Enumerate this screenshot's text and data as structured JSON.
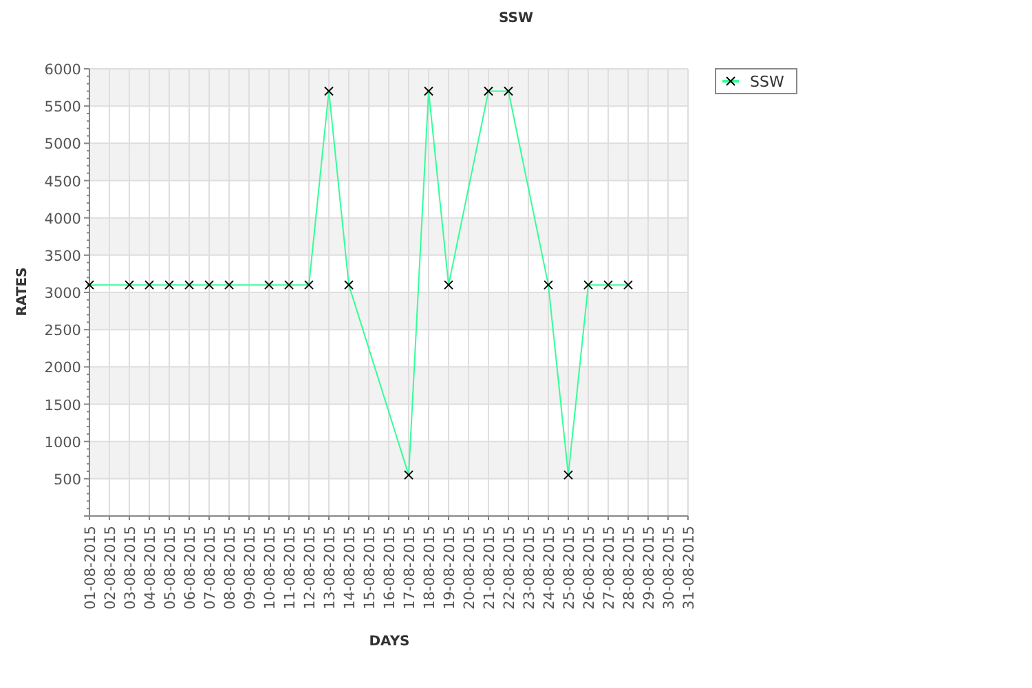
{
  "chart_data": {
    "type": "line",
    "title": "SSW",
    "xlabel": "DAYS",
    "ylabel": "RATES",
    "categories": [
      "01-08-2015",
      "02-08-2015",
      "03-08-2015",
      "04-08-2015",
      "05-08-2015",
      "06-08-2015",
      "07-08-2015",
      "08-08-2015",
      "09-08-2015",
      "10-08-2015",
      "11-08-2015",
      "12-08-2015",
      "13-08-2015",
      "14-08-2015",
      "15-08-2015",
      "16-08-2015",
      "17-08-2015",
      "18-08-2015",
      "19-08-2015",
      "20-08-2015",
      "21-08-2015",
      "22-08-2015",
      "23-08-2015",
      "24-08-2015",
      "25-08-2015",
      "26-08-2015",
      "27-08-2015",
      "28-08-2015",
      "29-08-2015",
      "30-08-2015",
      "31-08-2015"
    ],
    "grid": true,
    "series": [
      {
        "name": "SSW",
        "color": "#33ff99",
        "marker": "x",
        "values": [
          3100,
          null,
          3100,
          3100,
          3100,
          3100,
          3100,
          3100,
          null,
          3100,
          3100,
          3100,
          5700,
          3100,
          null,
          null,
          550,
          5700,
          3100,
          null,
          5700,
          5700,
          null,
          3100,
          550,
          3100,
          3100,
          3100,
          null,
          null,
          null
        ]
      }
    ],
    "ylim": [
      0,
      6000
    ],
    "yticks": [
      500,
      1000,
      1500,
      2000,
      2500,
      3000,
      3500,
      4000,
      4500,
      5000,
      5500,
      6000
    ]
  }
}
